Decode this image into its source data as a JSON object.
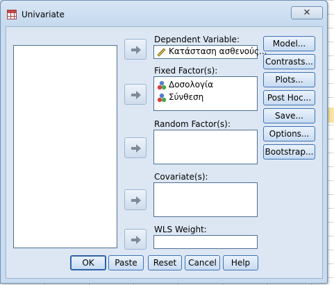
{
  "window": {
    "title": "Univariate",
    "close_glyph": "✕"
  },
  "fields": {
    "dependent": {
      "label": "Dependent Variable:",
      "value": "Κατάσταση ασθενούς..."
    },
    "fixed": {
      "label": "Fixed Factor(s):",
      "items": [
        "Δοσολογία",
        "Σύνθεση"
      ]
    },
    "random": {
      "label": "Random Factor(s):"
    },
    "covariate": {
      "label": "Covariate(s):"
    },
    "wls": {
      "label": "WLS Weight:"
    }
  },
  "side_buttons": [
    "Model...",
    "Contrasts...",
    "Plots...",
    "Post Hoc...",
    "Save...",
    "Options...",
    "Bootstrap..."
  ],
  "bottom_buttons": [
    "OK",
    "Paste",
    "Reset",
    "Cancel",
    "Help"
  ],
  "icons": {
    "app": "spreadsheet-icon",
    "move": "right-arrow-icon",
    "scale_variable": "ruler-icon",
    "nominal_variable": "nominal-variable-icon"
  },
  "colors": {
    "dialog_bg": "#c9dbef",
    "button_border": "#3b73b5",
    "arrow_fill": "#7d8a99"
  }
}
